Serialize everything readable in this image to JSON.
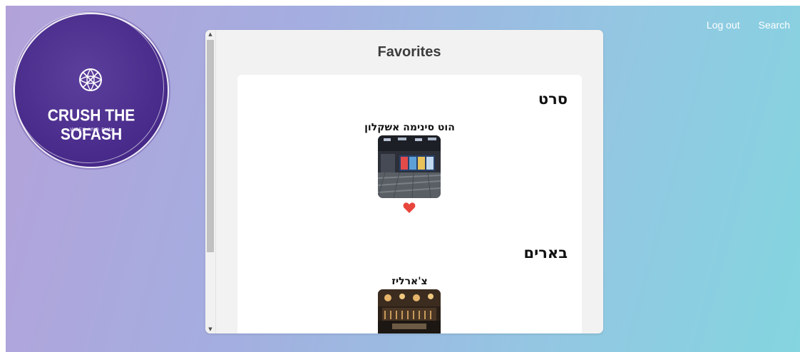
{
  "logo": {
    "title": "CRUSH THE SOFASH",
    "subtitle": "WEEK-AND FUN",
    "icon": "globe-lines-icon",
    "color": "#4a2c8c"
  },
  "nav": {
    "logout_label": "Log out",
    "search_label": "Search"
  },
  "panel": {
    "title": "Favorites"
  },
  "sections": [
    {
      "title": "סרט",
      "items": [
        {
          "name": "הוט סינימה אשקלון",
          "favorited": true
        }
      ]
    },
    {
      "title": "בארים",
      "items": [
        {
          "name": "צ'ארליז",
          "favorited": true
        }
      ]
    }
  ],
  "colors": {
    "heart": "#e8453c",
    "accent": "#4a2c8c"
  }
}
